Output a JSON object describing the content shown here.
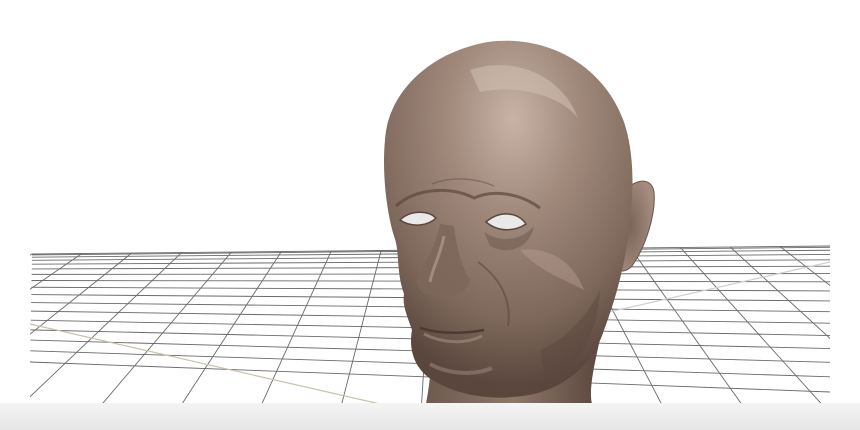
{
  "viewport": {
    "background_color": "#ffffff",
    "bottom_bar_color": "#ebebeb"
  },
  "grid": {
    "line_color": "#6a6a6a",
    "axis_x_color": "#c8c0a8",
    "axis_z_color": "#cfcfcf",
    "visible": true
  },
  "model": {
    "name": "bald-human-head",
    "material": "clay",
    "base_color": "#8b7466",
    "highlight_color": "#b8a194",
    "shadow_color": "#5a463d",
    "eye_color": "#e9e9e9"
  }
}
